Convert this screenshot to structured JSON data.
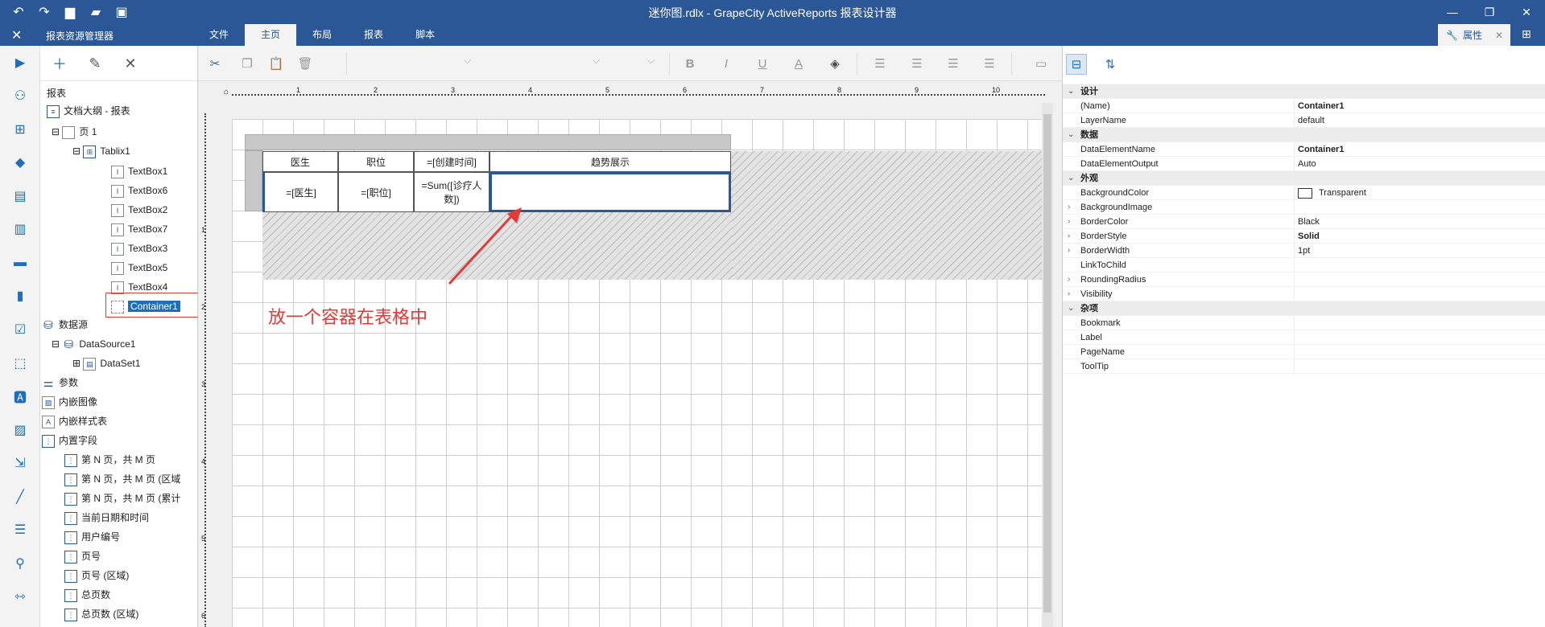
{
  "window": {
    "title": "迷你图.rdlx - GrapeCity ActiveReports 报表设计器"
  },
  "menubar": {
    "explorer_title": "报表资源管理器",
    "tabs": [
      {
        "label": "文件",
        "active": false
      },
      {
        "label": "主页",
        "active": true
      },
      {
        "label": "布局",
        "active": false
      },
      {
        "label": "报表",
        "active": false
      },
      {
        "label": "脚本",
        "active": false
      }
    ],
    "properties_tab": "属性"
  },
  "explorer": {
    "root": "报表",
    "outline": "文档大纲 - 报表",
    "page": "页 1",
    "tablix": "Tablix1",
    "textboxes": [
      "TextBox1",
      "TextBox6",
      "TextBox2",
      "TextBox7",
      "TextBox3",
      "TextBox5",
      "TextBox4"
    ],
    "container": "Container1",
    "datasources": "数据源",
    "datasource1": "DataSource1",
    "dataset1": "DataSet1",
    "parameters": "参数",
    "embedded_images": "内嵌图像",
    "embedded_styles": "内嵌样式表",
    "builtin_fields": "内置字段",
    "fields": [
      "第 N 页，共 M 页",
      "第 N 页，共 M 页 (区域",
      "第 N 页，共 M 页 (累计",
      "当前日期和时间",
      "用户编号",
      "页号",
      "页号 (区域)",
      "总页数",
      "总页数 (区域)"
    ]
  },
  "ribbon": {
    "bold": "B",
    "italic": "I",
    "underline": "U",
    "font_color": "A"
  },
  "ruler": {
    "top_marks": [
      "1",
      "2",
      "3",
      "4",
      "5",
      "6",
      "7",
      "8",
      "9",
      "10"
    ],
    "left_marks": [
      "1",
      "2",
      "3",
      "4",
      "5",
      "6"
    ]
  },
  "table": {
    "headers": [
      "医生",
      "职位",
      "=[创建时间]",
      "趋势展示"
    ],
    "cells": [
      "=[医生]",
      "=[职位]",
      "=Sum([诊疗人数])",
      ""
    ]
  },
  "annotation": "放一个容器在表格中",
  "properties": {
    "categories": [
      {
        "name": "设计",
        "rows": [
          {
            "key": "(Name)",
            "value": "Container1",
            "bold": true
          },
          {
            "key": "LayerName",
            "value": "default",
            "bold": false
          }
        ]
      },
      {
        "name": "数据",
        "rows": [
          {
            "key": "DataElementName",
            "value": "Container1",
            "bold": true
          },
          {
            "key": "DataElementOutput",
            "value": "Auto",
            "bold": false
          }
        ]
      },
      {
        "name": "外观",
        "rows": [
          {
            "key": "BackgroundColor",
            "value": "Transparent",
            "bold": false,
            "swatch": true
          },
          {
            "key": "BackgroundImage",
            "value": "",
            "bold": false,
            "expand": true
          },
          {
            "key": "BorderColor",
            "value": "Black",
            "bold": false,
            "expand": true
          },
          {
            "key": "BorderStyle",
            "value": "Solid",
            "bold": true,
            "expand": true
          },
          {
            "key": "BorderWidth",
            "value": "1pt",
            "bold": false,
            "expand": true
          },
          {
            "key": "LinkToChild",
            "value": "",
            "bold": false
          },
          {
            "key": "RoundingRadius",
            "value": "",
            "bold": false,
            "expand": true
          },
          {
            "key": "Visibility",
            "value": "",
            "bold": false,
            "expand": true
          }
        ]
      },
      {
        "name": "杂项",
        "rows": [
          {
            "key": "Bookmark",
            "value": "",
            "bold": false
          },
          {
            "key": "Label",
            "value": "",
            "bold": false
          },
          {
            "key": "PageName",
            "value": "",
            "bold": false
          },
          {
            "key": "ToolTip",
            "value": "",
            "bold": false
          }
        ]
      }
    ]
  },
  "colors": {
    "titlebar": "#2b5797",
    "accent": "#1f6fb8",
    "annotation": "#e53935"
  }
}
